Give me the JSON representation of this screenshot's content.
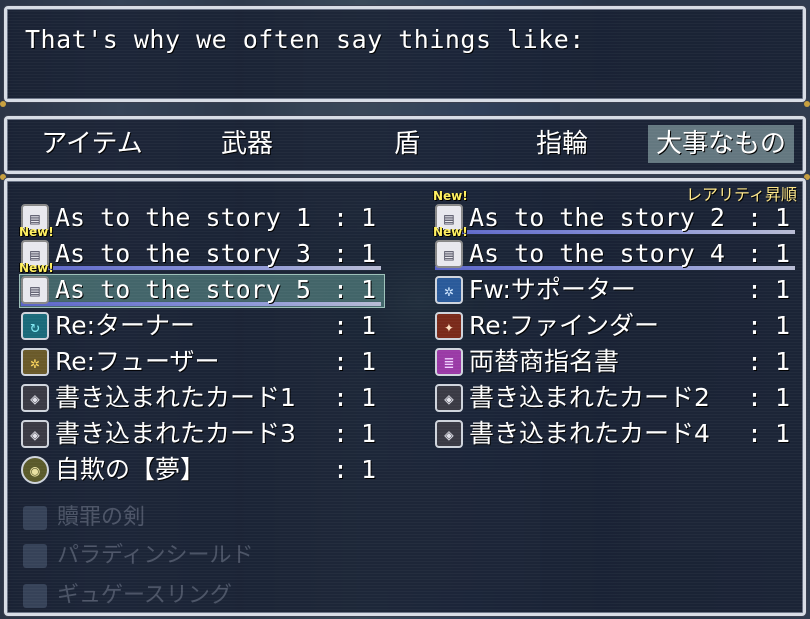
{
  "message": {
    "text": "That's why we often say things like:"
  },
  "categories": [
    {
      "label": "アイテム",
      "selected": false
    },
    {
      "label": "武器",
      "selected": false
    },
    {
      "label": "盾",
      "selected": false
    },
    {
      "label": "指輪",
      "selected": false
    },
    {
      "label": "大事なもの",
      "selected": true
    }
  ],
  "sort_label": "レアリティ昇順",
  "items": [
    {
      "name": "As to the story 1",
      "count": "1",
      "icon": "book-icon",
      "new": false,
      "selected": false,
      "bar": false
    },
    {
      "name": "As to the story 2",
      "count": "1",
      "icon": "book-icon",
      "new": true,
      "selected": false,
      "bar": true
    },
    {
      "name": "As to the story 3",
      "count": "1",
      "icon": "book-icon",
      "new": true,
      "selected": false,
      "bar": true
    },
    {
      "name": "As to the story 4",
      "count": "1",
      "icon": "book-icon",
      "new": true,
      "selected": false,
      "bar": true
    },
    {
      "name": "As to the story 5",
      "count": "1",
      "icon": "book-icon",
      "new": true,
      "selected": true,
      "bar": true
    },
    {
      "name": "Fw:サポーター",
      "count": "1",
      "icon": "gear-blue-icon",
      "new": false,
      "selected": false,
      "bar": false
    },
    {
      "name": "Re:ターナー",
      "count": "1",
      "icon": "cycle-icon",
      "new": false,
      "selected": false,
      "bar": false
    },
    {
      "name": "Re:ファインダー",
      "count": "1",
      "icon": "beast-icon",
      "new": false,
      "selected": false,
      "bar": false
    },
    {
      "name": "Re:フューザー",
      "count": "1",
      "icon": "gear-gold-icon",
      "new": false,
      "selected": false,
      "bar": false
    },
    {
      "name": "両替商指名書",
      "count": "1",
      "icon": "scroll-icon",
      "new": false,
      "selected": false,
      "bar": false
    },
    {
      "name": "書き込まれたカード1",
      "count": "1",
      "icon": "card-icon",
      "new": false,
      "selected": false,
      "bar": false
    },
    {
      "name": "書き込まれたカード2",
      "count": "1",
      "icon": "card-icon",
      "new": false,
      "selected": false,
      "bar": false
    },
    {
      "name": "書き込まれたカード3",
      "count": "1",
      "icon": "card-icon",
      "new": false,
      "selected": false,
      "bar": false
    },
    {
      "name": "書き込まれたカード4",
      "count": "1",
      "icon": "card-icon",
      "new": false,
      "selected": false,
      "bar": false
    },
    {
      "name": "自欺の【夢】",
      "count": "1",
      "icon": "eye-icon",
      "new": false,
      "selected": false,
      "bar": false
    }
  ],
  "new_badge": "New!",
  "colon": ":",
  "background_text": [
    "贖罪の剣",
    "パラディンシールド",
    "ギュゲースリング"
  ]
}
